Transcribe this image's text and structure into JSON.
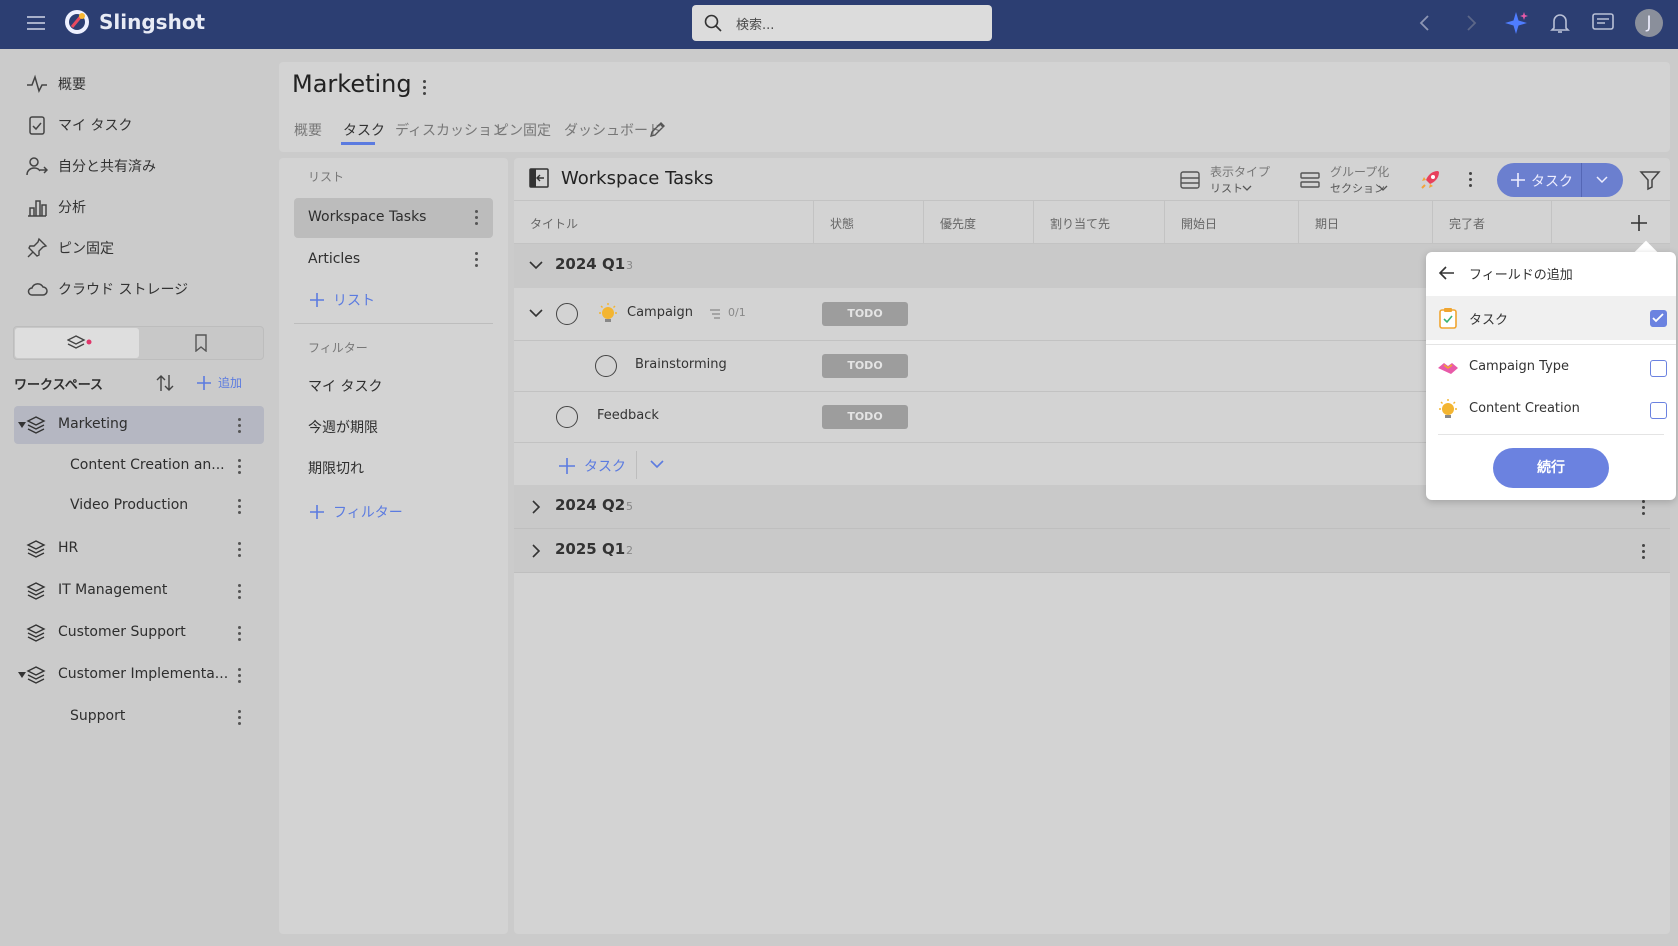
{
  "app": {
    "name": "Slingshot",
    "search_placeholder": "検索...",
    "avatar_initial": "J"
  },
  "nav": {
    "items": [
      {
        "label": "概要",
        "icon": "pulse-icon"
      },
      {
        "label": "マイ タスク",
        "icon": "clipboard-check-icon"
      },
      {
        "label": "自分と共有済み",
        "icon": "user-share-icon"
      },
      {
        "label": "分析",
        "icon": "bar-chart-icon"
      },
      {
        "label": "ピン固定",
        "icon": "pin-icon"
      },
      {
        "label": "クラウド ストレージ",
        "icon": "cloud-icon"
      }
    ]
  },
  "workspaces": {
    "title": "ワークスペース",
    "add_label": "追加",
    "items": [
      {
        "label": "Marketing"
      },
      {
        "label": "Content Creation an..."
      },
      {
        "label": "Video Production"
      },
      {
        "label": "HR"
      },
      {
        "label": "IT Management"
      },
      {
        "label": "Customer Support"
      },
      {
        "label": "Customer Implementa..."
      },
      {
        "label": "Support"
      }
    ]
  },
  "project": {
    "title": "Marketing",
    "tabs": [
      "概要",
      "タスク",
      "ディスカッション",
      "ピン固定",
      "ダッシュボード"
    ],
    "active_tab": "タスク"
  },
  "lists": {
    "caption": "リスト",
    "items": [
      "Workspace Tasks",
      "Articles"
    ],
    "add_list_label": "リスト",
    "filters_caption": "フィルター",
    "filters": [
      "マイ タスク",
      "今週が期限",
      "期限切れ"
    ],
    "add_filter_label": "フィルター"
  },
  "main": {
    "title": "Workspace Tasks",
    "view_type_label": "表示タイプ",
    "view_type_value": "リスト",
    "group_label": "グループ化",
    "group_value": "セクション",
    "add_task_label": "タスク",
    "columns": [
      "タイトル",
      "状態",
      "優先度",
      "割り当て先",
      "開始日",
      "期日",
      "完了者"
    ],
    "groups": [
      {
        "label": "2024 Q1",
        "count": "3"
      },
      {
        "label": "2024 Q2",
        "count": "5"
      },
      {
        "label": "2025 Q1",
        "count": "2"
      }
    ],
    "tasks": [
      {
        "title": "Campaign",
        "subtasks": "0/1",
        "status": "TODO"
      },
      {
        "title": "Brainstorming",
        "status": "TODO"
      },
      {
        "title": "Feedback",
        "status": "TODO"
      }
    ],
    "inline_add_label": "タスク"
  },
  "popup": {
    "title": "フィールドの追加",
    "options": [
      {
        "label": "タスク",
        "checked": true
      },
      {
        "label": "Campaign Type",
        "checked": false
      },
      {
        "label": "Content Creation",
        "checked": false
      }
    ],
    "continue_label": "続行"
  },
  "colors": {
    "topbar": "#2c3e72",
    "accent": "#6b82e0",
    "background": "#cbcbcb"
  }
}
